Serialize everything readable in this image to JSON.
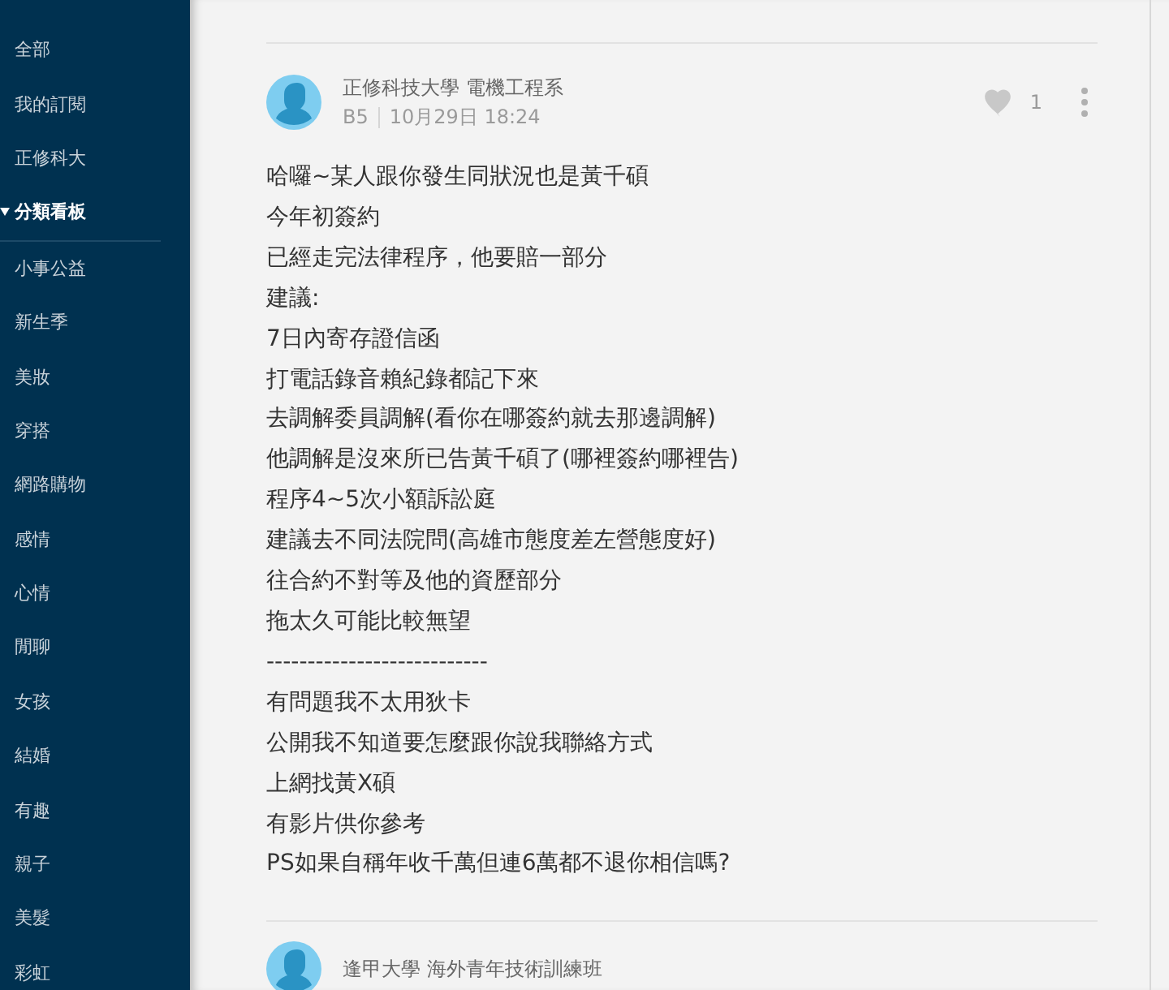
{
  "sidebar": {
    "items": [
      {
        "label": "全部",
        "selected": false
      },
      {
        "label": "我的訂閱",
        "selected": false
      },
      {
        "label": "正修科大",
        "selected": false
      },
      {
        "label": "分類看板",
        "selected": true
      },
      {
        "label": "小事公益",
        "selected": false
      },
      {
        "label": "新生季",
        "selected": false
      },
      {
        "label": "美妝",
        "selected": false
      },
      {
        "label": "穿搭",
        "selected": false
      },
      {
        "label": "網路購物",
        "selected": false
      },
      {
        "label": "感情",
        "selected": false
      },
      {
        "label": "心情",
        "selected": false
      },
      {
        "label": "閒聊",
        "selected": false
      },
      {
        "label": "女孩",
        "selected": false
      },
      {
        "label": "結婚",
        "selected": false
      },
      {
        "label": "有趣",
        "selected": false
      },
      {
        "label": "親子",
        "selected": false
      },
      {
        "label": "美髮",
        "selected": false
      },
      {
        "label": "彩虹",
        "selected": false
      }
    ]
  },
  "comments": [
    {
      "author": "正修科技大學 電機工程系",
      "floor": "B5",
      "time": "10月29日 18:24",
      "likes": "1",
      "liked": false,
      "lines": [
        "哈囉~某人跟你發生同狀況也是黃千碩",
        "今年初簽約",
        "已經走完法律程序，他要賠一部分",
        "建議:",
        "7日內寄存證信函",
        "打電話錄音賴紀錄都記下來",
        "去調解委員調解(看你在哪簽約就去那邊調解)",
        "他調解是沒來所已告黃千碩了(哪裡簽約哪裡告)",
        "程序4~5次小額訴訟庭",
        "建議去不同法院問(高雄市態度差左營態度好)",
        "往合約不對等及他的資歷部分",
        "拖太久可能比較無望",
        "---------------------------",
        "有問題我不太用狄卡",
        "公開我不知道要怎麼跟你說我聯絡方式",
        "上網找黃X碩",
        "有影片供你參考",
        "PS如果自稱年收千萬但連6萬都不退你相信嗎?"
      ]
    },
    {
      "author": "逢甲大學 海外青年技術訓練班"
    }
  ]
}
